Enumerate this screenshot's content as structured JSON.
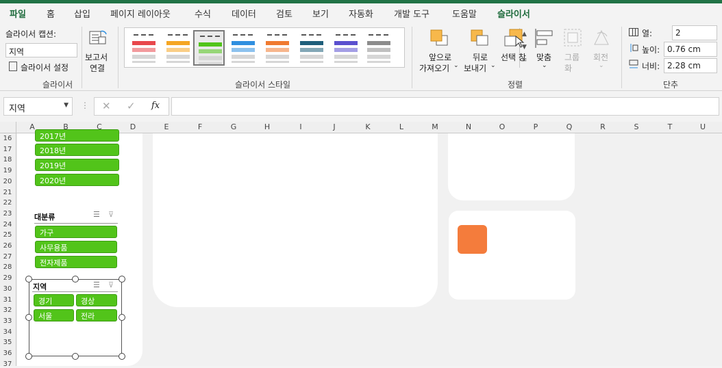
{
  "tabs": [
    "파일",
    "홈",
    "삽입",
    "페이지 레이아웃",
    "수식",
    "데이터",
    "검토",
    "보기",
    "자동화",
    "개발 도구",
    "도움말",
    "슬라이서"
  ],
  "slicer_group": {
    "caption_label": "슬라이서 캡션:",
    "caption_value": "지역",
    "settings_label": "슬라이서 설정",
    "report_label_1": "보고서",
    "report_label_2": "연결",
    "group_label": "슬라이서"
  },
  "styles_group": {
    "group_label": "슬라이서 스타일",
    "swatches": [
      {
        "color": "#e8474c"
      },
      {
        "color": "#f5a623"
      },
      {
        "color": "#52c41a"
      },
      {
        "color": "#2f8fe0"
      },
      {
        "color": "#f07a30"
      },
      {
        "color": "#1e5e7a"
      },
      {
        "color": "#5a4fcf"
      },
      {
        "color": "#8c8c8c"
      }
    ]
  },
  "arrange_group": {
    "forward_1": "앞으로",
    "forward_2": "가져오기",
    "back_1": "뒤로",
    "back_2": "보내기",
    "select_pane": "선택 창",
    "align": "맞춤",
    "group_1": "그룹",
    "group_2": "화",
    "rotate": "회전",
    "group_label": "정렬"
  },
  "buttons_group": {
    "columns_label": "열:",
    "columns_value": "2",
    "height_label": "높이:",
    "height_value": "0.76 cm",
    "width_label": "너비:",
    "width_value": "2.28 cm",
    "group_label": "단추"
  },
  "formula_bar": {
    "name_box": "지역",
    "fx": "fx"
  },
  "columns": [
    "A",
    "B",
    "C",
    "D",
    "E",
    "F",
    "G",
    "H",
    "I",
    "J",
    "K",
    "L",
    "M",
    "N",
    "O",
    "P",
    "Q",
    "R",
    "S",
    "T",
    "U"
  ],
  "rows": [
    "16",
    "17",
    "18",
    "19",
    "20",
    "21",
    "22",
    "23",
    "24",
    "25",
    "26",
    "27",
    "28",
    "29",
    "30",
    "31",
    "32",
    "33",
    "34",
    "35",
    "36",
    "37"
  ],
  "slicer_years": {
    "items": [
      "2017년",
      "2018년",
      "2019년",
      "2020년"
    ]
  },
  "slicer_category": {
    "title": "대분류",
    "items": [
      "가구",
      "사무용품",
      "전자제품"
    ]
  },
  "slicer_region": {
    "title": "지역",
    "items": [
      "경기",
      "경상",
      "서울",
      "전라"
    ]
  },
  "colors": {
    "accent": "#217346",
    "slicer_green": "#52c41a",
    "orange_tile": "#f47c3c"
  }
}
